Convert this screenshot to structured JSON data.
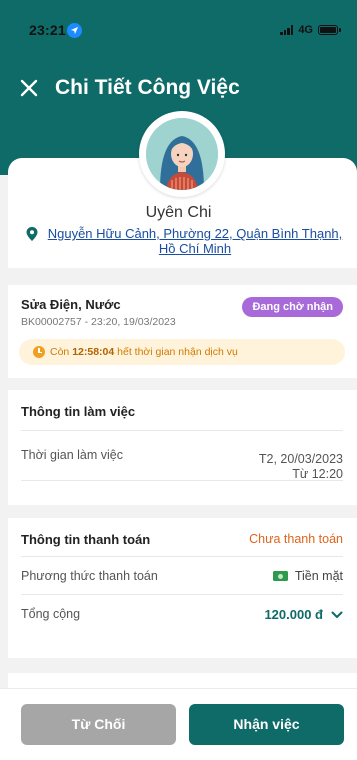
{
  "status_bar": {
    "time": "23:21",
    "network": "4G"
  },
  "header": {
    "title": "Chi Tiết Công Việc"
  },
  "customer": {
    "name": "Uyên Chi",
    "address": "Nguyễn Hữu Cảnh, Phường 22, Quận Bình Thạnh, Hồ Chí Minh"
  },
  "service": {
    "name": "Sửa Điện, Nước",
    "code": "BK00002757 - 23:20, 19/03/2023",
    "badge": "Đang chờ nhận",
    "timer_prefix": "Còn ",
    "timer_value": "12:58:04",
    "timer_suffix": " hết thời gian nhận dịch vụ"
  },
  "work_info": {
    "title": "Thông tin làm việc",
    "time_label": "Thời gian làm việc",
    "date": "T2, 20/03/2023",
    "time": "Từ 12:20"
  },
  "payment": {
    "title": "Thông tin thanh toán",
    "status": "Chưa thanh toán",
    "method_label": "Phương thức thanh toán",
    "method_value": "Tiền mặt",
    "total_label": "Tổng cộng",
    "total_value": "120.000 đ"
  },
  "actions": {
    "reject": "Từ Chối",
    "accept": "Nhận việc"
  },
  "colors": {
    "primary": "#0e6b68",
    "badge": "#a76ad8",
    "unpaid": "#e0641c",
    "timer_bg": "#fff3dc",
    "reject_btn": "#a6a6a6"
  },
  "icons": {
    "close": "close-icon",
    "location": "location-pin-icon",
    "timer": "clock-icon",
    "cash": "cash-icon",
    "expand": "chevron-down-icon"
  }
}
